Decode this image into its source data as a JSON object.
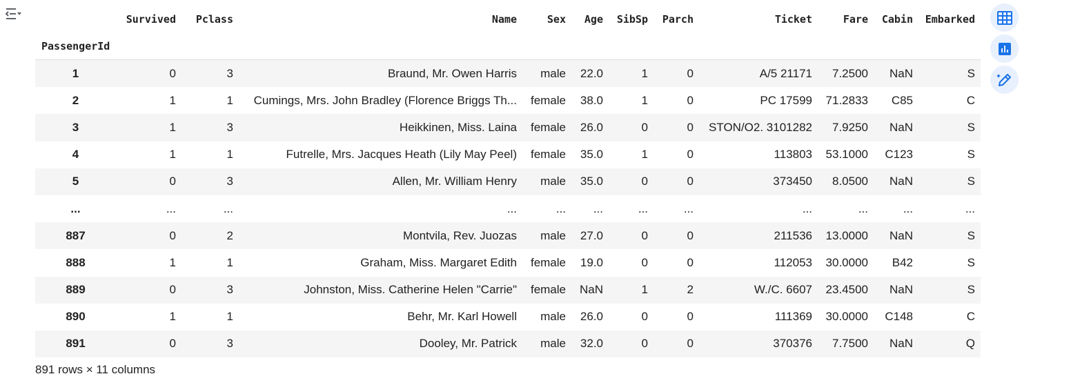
{
  "colors": {
    "accent": "#1a73e8",
    "stripe": "#f5f5f5"
  },
  "toolbar": {
    "toggle_icon": "collapse-output-icon",
    "side_buttons": [
      {
        "icon": "table-icon"
      },
      {
        "icon": "bar-chart-icon"
      },
      {
        "icon": "magic-pencil-icon"
      }
    ]
  },
  "table": {
    "index_name": "PassengerId",
    "columns": [
      "Survived",
      "Pclass",
      "Name",
      "Sex",
      "Age",
      "SibSp",
      "Parch",
      "Ticket",
      "Fare",
      "Cabin",
      "Embarked"
    ],
    "rows": [
      {
        "index": "1",
        "cells": [
          "0",
          "3",
          "Braund, Mr. Owen Harris",
          "male",
          "22.0",
          "1",
          "0",
          "A/5 21171",
          "7.2500",
          "NaN",
          "S"
        ]
      },
      {
        "index": "2",
        "cells": [
          "1",
          "1",
          "Cumings, Mrs. John Bradley (Florence Briggs Th...",
          "female",
          "38.0",
          "1",
          "0",
          "PC 17599",
          "71.2833",
          "C85",
          "C"
        ]
      },
      {
        "index": "3",
        "cells": [
          "1",
          "3",
          "Heikkinen, Miss. Laina",
          "female",
          "26.0",
          "0",
          "0",
          "STON/O2. 3101282",
          "7.9250",
          "NaN",
          "S"
        ]
      },
      {
        "index": "4",
        "cells": [
          "1",
          "1",
          "Futrelle, Mrs. Jacques Heath (Lily May Peel)",
          "female",
          "35.0",
          "1",
          "0",
          "113803",
          "53.1000",
          "C123",
          "S"
        ]
      },
      {
        "index": "5",
        "cells": [
          "0",
          "3",
          "Allen, Mr. William Henry",
          "male",
          "35.0",
          "0",
          "0",
          "373450",
          "8.0500",
          "NaN",
          "S"
        ]
      },
      {
        "index": "...",
        "cells": [
          "...",
          "...",
          "...",
          "...",
          "...",
          "...",
          "...",
          "...",
          "...",
          "...",
          "..."
        ]
      },
      {
        "index": "887",
        "cells": [
          "0",
          "2",
          "Montvila, Rev. Juozas",
          "male",
          "27.0",
          "0",
          "0",
          "211536",
          "13.0000",
          "NaN",
          "S"
        ]
      },
      {
        "index": "888",
        "cells": [
          "1",
          "1",
          "Graham, Miss. Margaret Edith",
          "female",
          "19.0",
          "0",
          "0",
          "112053",
          "30.0000",
          "B42",
          "S"
        ]
      },
      {
        "index": "889",
        "cells": [
          "0",
          "3",
          "Johnston, Miss. Catherine Helen \"Carrie\"",
          "female",
          "NaN",
          "1",
          "2",
          "W./C. 6607",
          "23.4500",
          "NaN",
          "S"
        ]
      },
      {
        "index": "890",
        "cells": [
          "1",
          "1",
          "Behr, Mr. Karl Howell",
          "male",
          "26.0",
          "0",
          "0",
          "111369",
          "30.0000",
          "C148",
          "C"
        ]
      },
      {
        "index": "891",
        "cells": [
          "0",
          "3",
          "Dooley, Mr. Patrick",
          "male",
          "32.0",
          "0",
          "0",
          "370376",
          "7.7500",
          "NaN",
          "Q"
        ]
      }
    ]
  },
  "footer": {
    "shape_text": "891 rows × 11 columns"
  }
}
